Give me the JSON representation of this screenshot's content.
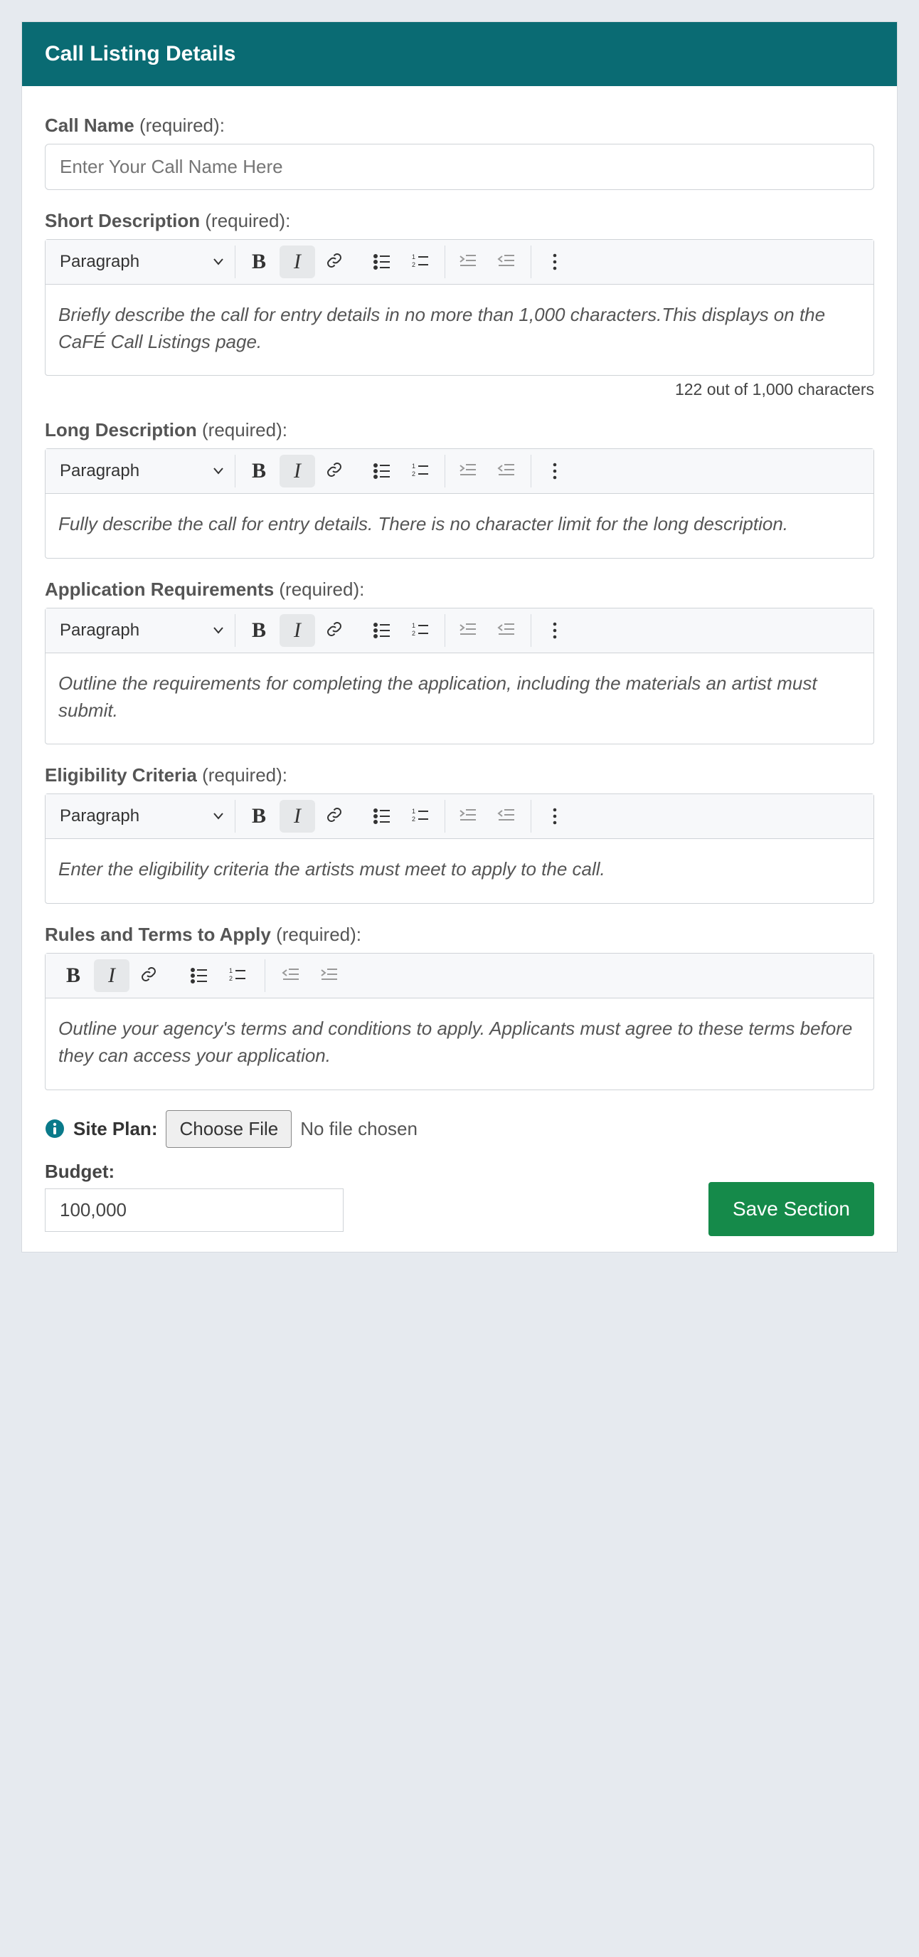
{
  "header": {
    "title": "Call Listing Details"
  },
  "required_text": "(required)",
  "colon": ":",
  "fields": {
    "call_name": {
      "label": "Call Name",
      "placeholder": "Enter Your Call Name Here"
    },
    "short_desc": {
      "label": "Short Description",
      "block_format": "Paragraph",
      "content": "Briefly describe the call for entry details in no more than 1,000 characters.This displays on the CaFÉ Call Listings page.",
      "char_count": "122 out of 1,000 characters"
    },
    "long_desc": {
      "label": "Long Description",
      "block_format": "Paragraph",
      "content": "Fully describe the call for entry details. There is no character limit for the long description."
    },
    "app_req": {
      "label": "Application Requirements",
      "block_format": "Paragraph",
      "content": "Outline the requirements for completing the application, including the materials an artist must submit."
    },
    "eligibility": {
      "label": "Eligibility Criteria",
      "block_format": "Paragraph",
      "content": "Enter the eligibility criteria the artists must meet to apply to the call."
    },
    "rules": {
      "label": "Rules and Terms to Apply",
      "content": "Outline your agency's terms and conditions to apply. Applicants must agree to these terms before they can access your application."
    }
  },
  "siteplan": {
    "label": "Site Plan:",
    "button": "Choose File",
    "status": "No file chosen"
  },
  "budget": {
    "label": "Budget:",
    "value": "100,000"
  },
  "save_button": "Save Section"
}
